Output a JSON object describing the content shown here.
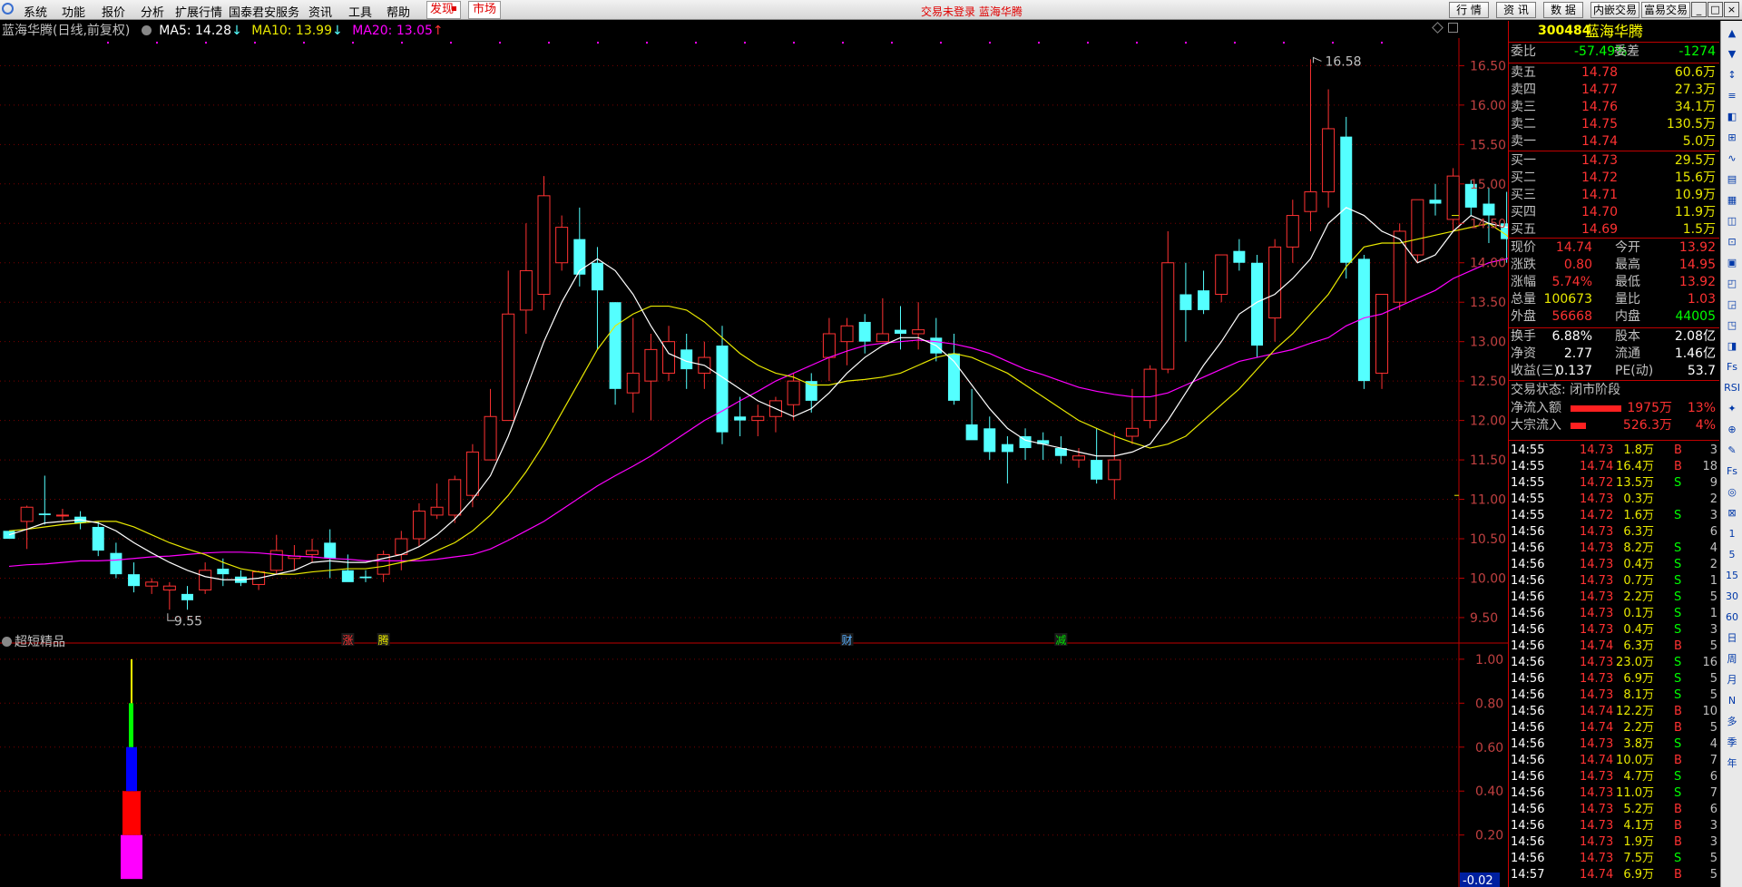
{
  "menubar": {
    "items": [
      "系统",
      "功能",
      "报价",
      "分析",
      "扩展行情",
      "国泰君安服务",
      "资讯",
      "工具",
      "帮助"
    ],
    "faxian": "发现",
    "shichang": "市场",
    "center_title": "交易未登录  蓝海华腾",
    "buttons": [
      "行 情",
      "资 讯",
      "数 据",
      "内嵌交易",
      "富易交易"
    ],
    "window_buttons": [
      "_",
      "□",
      "×"
    ]
  },
  "chart": {
    "title": "蓝海华腾(日线,前复权)",
    "ma5_label": "MA5: 14.28",
    "ma5_arrow": "↓",
    "ma10_label": "MA10: 13.99",
    "ma10_arrow": "↓",
    "ma20_label": "MA20: 13.05",
    "ma20_arrow": "↑",
    "high_label": "16.58",
    "low_label": "9.55",
    "price_ticks": [
      "16.50",
      "16.00",
      "15.50",
      "15.00",
      "14.50",
      "14.00",
      "13.50",
      "13.00",
      "12.50",
      "12.00",
      "11.50",
      "11.00",
      "10.50",
      "10.00",
      "9.50"
    ],
    "event_markers": [
      "涨",
      "腾",
      "财",
      "减"
    ],
    "colors": {
      "up": "#ff3232",
      "down": "#54ffff",
      "ma5": "#ffffff",
      "ma10": "#e8e800",
      "ma20": "#ff00ff",
      "grid": "#7a0000"
    }
  },
  "chart_data": {
    "type": "candlestick",
    "candles": [
      [
        10.6,
        10.5,
        10.55,
        10.5
      ],
      [
        10.72,
        10.92,
        10.37,
        10.9
      ],
      [
        10.82,
        11.3,
        10.68,
        10.8
      ],
      [
        10.8,
        10.88,
        10.72,
        10.8
      ],
      [
        10.78,
        10.85,
        10.62,
        10.7
      ],
      [
        10.65,
        10.72,
        10.28,
        10.35
      ],
      [
        10.32,
        10.45,
        10.0,
        10.05
      ],
      [
        10.05,
        10.2,
        9.82,
        9.9
      ],
      [
        9.9,
        10.0,
        9.8,
        9.95
      ],
      [
        9.85,
        9.95,
        9.6,
        9.9
      ],
      [
        9.8,
        9.9,
        9.6,
        9.72
      ],
      [
        9.85,
        10.2,
        9.8,
        10.1
      ],
      [
        10.12,
        10.25,
        9.9,
        10.05
      ],
      [
        10.02,
        10.1,
        9.9,
        9.94
      ],
      [
        9.92,
        10.1,
        9.85,
        10.08
      ],
      [
        10.1,
        10.55,
        10.05,
        10.35
      ],
      [
        10.25,
        10.42,
        10.1,
        10.28
      ],
      [
        10.3,
        10.5,
        10.2,
        10.35
      ],
      [
        10.45,
        10.62,
        10.0,
        10.25
      ],
      [
        10.1,
        10.3,
        10.0,
        9.95
      ],
      [
        10.02,
        10.1,
        9.95,
        10.0
      ],
      [
        10.05,
        10.35,
        9.95,
        10.3
      ],
      [
        10.3,
        10.6,
        10.1,
        10.5
      ],
      [
        10.5,
        10.95,
        10.4,
        10.85
      ],
      [
        10.8,
        11.2,
        10.75,
        10.9
      ],
      [
        10.8,
        11.3,
        10.7,
        11.25
      ],
      [
        11.05,
        11.7,
        10.9,
        11.6
      ],
      [
        11.5,
        12.4,
        11.5,
        12.05
      ],
      [
        12.0,
        13.9,
        12.0,
        13.35
      ],
      [
        13.4,
        14.5,
        13.1,
        13.9
      ],
      [
        13.6,
        15.1,
        13.4,
        14.85
      ],
      [
        14.0,
        14.6,
        13.9,
        14.45
      ],
      [
        14.3,
        14.7,
        13.7,
        13.85
      ],
      [
        14.0,
        14.2,
        12.9,
        13.65
      ],
      [
        13.5,
        13.5,
        12.2,
        12.4
      ],
      [
        12.35,
        13.3,
        12.1,
        12.6
      ],
      [
        12.5,
        13.1,
        12.0,
        12.9
      ],
      [
        12.6,
        13.2,
        12.5,
        13.0
      ],
      [
        12.9,
        13.1,
        12.4,
        12.65
      ],
      [
        12.6,
        13.0,
        12.4,
        12.8
      ],
      [
        12.95,
        13.2,
        11.7,
        11.85
      ],
      [
        12.05,
        12.3,
        11.8,
        12.0
      ],
      [
        12.0,
        12.2,
        11.8,
        12.05
      ],
      [
        12.05,
        12.3,
        11.85,
        12.25
      ],
      [
        12.2,
        12.6,
        12.0,
        12.5
      ],
      [
        12.5,
        12.6,
        12.1,
        12.25
      ],
      [
        12.8,
        13.3,
        12.5,
        13.1
      ],
      [
        13.0,
        13.3,
        12.7,
        13.2
      ],
      [
        13.25,
        13.35,
        12.85,
        13.0
      ],
      [
        13.0,
        13.55,
        13.0,
        13.1
      ],
      [
        13.15,
        13.45,
        12.9,
        13.1
      ],
      [
        13.1,
        13.5,
        12.9,
        13.15
      ],
      [
        13.05,
        13.3,
        12.75,
        12.85
      ],
      [
        12.85,
        13.1,
        12.2,
        12.25
      ],
      [
        11.95,
        12.4,
        11.8,
        11.75
      ],
      [
        11.9,
        12.05,
        11.5,
        11.6
      ],
      [
        11.7,
        11.8,
        11.2,
        11.6
      ],
      [
        11.8,
        11.9,
        11.5,
        11.65
      ],
      [
        11.75,
        11.85,
        11.5,
        11.7
      ],
      [
        11.65,
        11.8,
        11.45,
        11.55
      ],
      [
        11.5,
        11.65,
        11.4,
        11.55
      ],
      [
        11.5,
        11.9,
        11.2,
        11.25
      ],
      [
        11.25,
        11.85,
        11.0,
        11.5
      ],
      [
        11.8,
        12.4,
        11.7,
        11.9
      ],
      [
        12.0,
        12.7,
        11.9,
        12.65
      ],
      [
        12.65,
        14.4,
        12.6,
        14.0
      ],
      [
        13.6,
        14.0,
        13.0,
        13.4
      ],
      [
        13.65,
        13.9,
        13.35,
        13.4
      ],
      [
        13.6,
        14.05,
        13.5,
        14.1
      ],
      [
        14.15,
        14.3,
        13.9,
        14.0
      ],
      [
        14.0,
        14.1,
        12.8,
        12.95
      ],
      [
        13.3,
        14.3,
        13.0,
        14.2
      ],
      [
        14.2,
        14.8,
        14.0,
        14.6
      ],
      [
        14.65,
        16.58,
        14.4,
        14.9
      ],
      [
        14.9,
        16.2,
        14.7,
        15.7
      ],
      [
        15.6,
        15.85,
        13.8,
        14.0
      ],
      [
        14.05,
        14.1,
        12.4,
        12.5
      ],
      [
        12.6,
        13.3,
        12.4,
        13.6
      ],
      [
        13.5,
        14.5,
        13.4,
        14.4
      ],
      [
        14.1,
        14.8,
        14.0,
        14.8
      ],
      [
        14.8,
        15.0,
        14.6,
        14.75
      ],
      [
        14.55,
        15.2,
        14.4,
        15.1
      ],
      [
        15.0,
        15.05,
        14.6,
        14.7
      ],
      [
        14.75,
        14.95,
        14.25,
        14.6
      ],
      [
        14.5,
        14.9,
        14.0,
        14.3
      ],
      [
        14.15,
        14.5,
        13.8,
        14.0
      ],
      [
        14.0,
        14.9,
        14.0,
        14.74
      ]
    ],
    "ma5": [
      10.55,
      10.62,
      10.7,
      10.72,
      10.74,
      10.7,
      10.6,
      10.45,
      10.32,
      10.2,
      10.1,
      10.02,
      9.98,
      9.98,
      10.0,
      10.05,
      10.1,
      10.2,
      10.22,
      10.2,
      10.2,
      10.25,
      10.3,
      10.4,
      10.55,
      10.75,
      11.0,
      11.3,
      11.8,
      12.4,
      13.0,
      13.5,
      13.9,
      14.05,
      13.9,
      13.6,
      13.2,
      12.85,
      12.75,
      12.7,
      12.55,
      12.4,
      12.25,
      12.15,
      12.05,
      12.15,
      12.35,
      12.6,
      12.8,
      12.95,
      13.05,
      13.05,
      12.95,
      12.75,
      12.45,
      12.15,
      11.9,
      11.75,
      11.7,
      11.65,
      11.6,
      11.55,
      11.55,
      11.6,
      11.7,
      12.0,
      12.35,
      12.7,
      13.0,
      13.35,
      13.5,
      13.6,
      13.8,
      14.05,
      14.5,
      14.7,
      14.6,
      14.4,
      14.3,
      14.0,
      14.1,
      14.4,
      14.6,
      14.5,
      14.45,
      14.5
    ],
    "ma10": [
      10.6,
      10.62,
      10.65,
      10.68,
      10.7,
      10.72,
      10.72,
      10.65,
      10.55,
      10.45,
      10.37,
      10.3,
      10.2,
      10.12,
      10.08,
      10.05,
      10.05,
      10.08,
      10.1,
      10.12,
      10.12,
      10.15,
      10.2,
      10.25,
      10.35,
      10.45,
      10.6,
      10.8,
      11.05,
      11.35,
      11.7,
      12.1,
      12.5,
      12.9,
      13.2,
      13.35,
      13.45,
      13.45,
      13.4,
      13.25,
      13.05,
      12.85,
      12.7,
      12.6,
      12.55,
      12.45,
      12.45,
      12.5,
      12.52,
      12.55,
      12.6,
      12.7,
      12.8,
      12.85,
      12.8,
      12.7,
      12.6,
      12.45,
      12.3,
      12.15,
      12.0,
      11.9,
      11.8,
      11.72,
      11.65,
      11.7,
      11.8,
      12.0,
      12.2,
      12.4,
      12.65,
      12.9,
      13.1,
      13.35,
      13.6,
      13.95,
      14.2,
      14.25,
      14.25,
      14.3,
      14.35,
      14.4,
      14.45,
      14.5,
      14.35,
      14.1
    ],
    "ma20": [
      10.15,
      10.17,
      10.18,
      10.2,
      10.22,
      10.22,
      10.23,
      10.25,
      10.27,
      10.28,
      10.3,
      10.32,
      10.33,
      10.33,
      10.32,
      10.3,
      10.28,
      10.27,
      10.25,
      10.24,
      10.22,
      10.22,
      10.22,
      10.22,
      10.24,
      10.27,
      10.3,
      10.37,
      10.48,
      10.6,
      10.72,
      10.87,
      11.02,
      11.17,
      11.3,
      11.42,
      11.55,
      11.7,
      11.85,
      12.0,
      12.12,
      12.25,
      12.37,
      12.5,
      12.6,
      12.7,
      12.8,
      12.88,
      12.95,
      12.98,
      13.0,
      13.02,
      13.0,
      12.97,
      12.92,
      12.85,
      12.75,
      12.65,
      12.58,
      12.5,
      12.42,
      12.37,
      12.33,
      12.3,
      12.3,
      12.35,
      12.45,
      12.55,
      12.65,
      12.75,
      12.8,
      12.85,
      12.9,
      12.98,
      13.05,
      13.2,
      13.3,
      13.35,
      13.45,
      13.55,
      13.65,
      13.8,
      13.9,
      14.0,
      14.05,
      14.15
    ],
    "ylim": [
      9.35,
      16.7
    ]
  },
  "indicator": {
    "title": "超短精品",
    "ticks": [
      "1.00",
      "0.80",
      "0.60",
      "0.40",
      "0.20"
    ],
    "current": "-0.02",
    "bars": [
      {
        "from": 0.0,
        "to": 0.2,
        "color": "#ff00ff"
      },
      {
        "from": 0.2,
        "to": 0.4,
        "color": "#ff0000"
      },
      {
        "from": 0.4,
        "to": 0.6,
        "color": "#0000ff"
      },
      {
        "from": 0.6,
        "to": 0.8,
        "color": "#00ff00"
      },
      {
        "from": 0.8,
        "to": 1.0,
        "color": "#ffff00"
      }
    ]
  },
  "quote": {
    "code": "300484",
    "name": "蓝海华腾",
    "weibi_label": "委比",
    "weibi": "-57.49%",
    "weicha_label": "委差",
    "weicha": "-1274",
    "sell": [
      {
        "label": "卖五",
        "price": "14.78",
        "vol": "60.6万"
      },
      {
        "label": "卖四",
        "price": "14.77",
        "vol": "27.3万"
      },
      {
        "label": "卖三",
        "price": "14.76",
        "vol": "34.1万"
      },
      {
        "label": "卖二",
        "price": "14.75",
        "vol": "130.5万"
      },
      {
        "label": "卖一",
        "price": "14.74",
        "vol": "5.0万"
      }
    ],
    "buy": [
      {
        "label": "买一",
        "price": "14.73",
        "vol": "29.5万"
      },
      {
        "label": "买二",
        "price": "14.72",
        "vol": "15.6万"
      },
      {
        "label": "买三",
        "price": "14.71",
        "vol": "10.9万"
      },
      {
        "label": "买四",
        "price": "14.70",
        "vol": "11.9万"
      },
      {
        "label": "买五",
        "price": "14.69",
        "vol": "1.5万"
      }
    ],
    "stats": [
      [
        "现价",
        "14.74",
        "今开",
        "13.92"
      ],
      [
        "涨跌",
        "0.80",
        "最高",
        "14.95"
      ],
      [
        "涨幅",
        "5.74%",
        "最低",
        "13.92"
      ],
      [
        "总量",
        "100673",
        "量比",
        "1.03"
      ],
      [
        "外盘",
        "56668",
        "内盘",
        "44005"
      ]
    ],
    "stats2": [
      [
        "换手",
        "6.88%",
        "股本",
        "2.08亿"
      ],
      [
        "净资",
        "2.77",
        "流通",
        "1.46亿"
      ],
      [
        "收益(三)",
        "0.137",
        "PE(动)",
        "53.7"
      ]
    ],
    "status": "交易状态: 闭市阶段",
    "flow": [
      {
        "label": "净流入额",
        "value": "1975万",
        "pct": "13%",
        "ratio": 0.13
      },
      {
        "label": "大宗流入",
        "value": "526.3万",
        "pct": "4%",
        "ratio": 0.04
      }
    ],
    "ticks": [
      [
        "14:55",
        "14.73",
        "1.8万",
        "B",
        "3"
      ],
      [
        "14:55",
        "14.74",
        "16.4万",
        "B",
        "18"
      ],
      [
        "14:55",
        "14.72",
        "13.5万",
        "S",
        "9"
      ],
      [
        "14:55",
        "14.73",
        "0.3万",
        "",
        "2"
      ],
      [
        "14:55",
        "14.72",
        "1.6万",
        "S",
        "3"
      ],
      [
        "14:56",
        "14.73",
        "6.3万",
        "",
        "6"
      ],
      [
        "14:56",
        "14.73",
        "8.2万",
        "S",
        "4"
      ],
      [
        "14:56",
        "14.73",
        "0.4万",
        "S",
        "2"
      ],
      [
        "14:56",
        "14.73",
        "0.7万",
        "S",
        "1"
      ],
      [
        "14:56",
        "14.73",
        "2.2万",
        "S",
        "5"
      ],
      [
        "14:56",
        "14.73",
        "0.1万",
        "S",
        "1"
      ],
      [
        "14:56",
        "14.73",
        "0.4万",
        "S",
        "3"
      ],
      [
        "14:56",
        "14.74",
        "6.3万",
        "B",
        "5"
      ],
      [
        "14:56",
        "14.73",
        "23.0万",
        "S",
        "16"
      ],
      [
        "14:56",
        "14.73",
        "6.9万",
        "S",
        "5"
      ],
      [
        "14:56",
        "14.73",
        "8.1万",
        "S",
        "5"
      ],
      [
        "14:56",
        "14.74",
        "12.2万",
        "B",
        "10"
      ],
      [
        "14:56",
        "14.74",
        "2.2万",
        "B",
        "5"
      ],
      [
        "14:56",
        "14.73",
        "3.8万",
        "S",
        "4"
      ],
      [
        "14:56",
        "14.74",
        "10.0万",
        "B",
        "7"
      ],
      [
        "14:56",
        "14.73",
        "4.7万",
        "S",
        "6"
      ],
      [
        "14:56",
        "14.73",
        "11.0万",
        "S",
        "7"
      ],
      [
        "14:56",
        "14.73",
        "5.2万",
        "B",
        "6"
      ],
      [
        "14:56",
        "14.73",
        "4.1万",
        "B",
        "3"
      ],
      [
        "14:56",
        "14.73",
        "1.9万",
        "B",
        "3"
      ],
      [
        "14:56",
        "14.73",
        "7.5万",
        "S",
        "5"
      ],
      [
        "14:57",
        "14.74",
        "6.9万",
        "B",
        "5"
      ]
    ]
  },
  "sidebar": {
    "icons": [
      "▲",
      "▼",
      "↕",
      "≡",
      "◧",
      "⊞",
      "∿",
      "▤",
      "▦",
      "◫",
      "⊡",
      "▣",
      "◰",
      "◲",
      "◳",
      "◨",
      "Fs",
      "RSI",
      "✦",
      "⊕",
      "✎",
      "Fs",
      "◎",
      "⊠",
      "1",
      "5",
      "15",
      "30",
      "60",
      "日",
      "周",
      "月",
      "N",
      "多",
      "季",
      "年"
    ]
  }
}
